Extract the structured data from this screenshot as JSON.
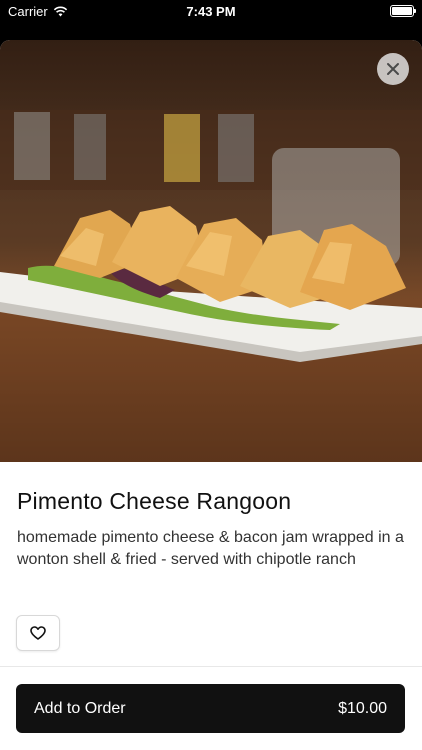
{
  "status_bar": {
    "carrier": "Carrier",
    "time": "7:43 PM"
  },
  "item": {
    "name": "Pimento Cheese Rangoon",
    "description": "homemade pimento cheese & bacon jam wrapped in a wonton shell & fried - served with chipotle ranch"
  },
  "order": {
    "add_label": "Add to Order",
    "price": "$10.00"
  },
  "icons": {
    "close": "close-icon",
    "favorite": "heart-icon",
    "wifi": "wifi-icon",
    "battery": "battery-icon"
  },
  "colors": {
    "primary_button": "#111111",
    "sheet_background": "#ffffff",
    "photo_wood": "#6a3f22"
  }
}
